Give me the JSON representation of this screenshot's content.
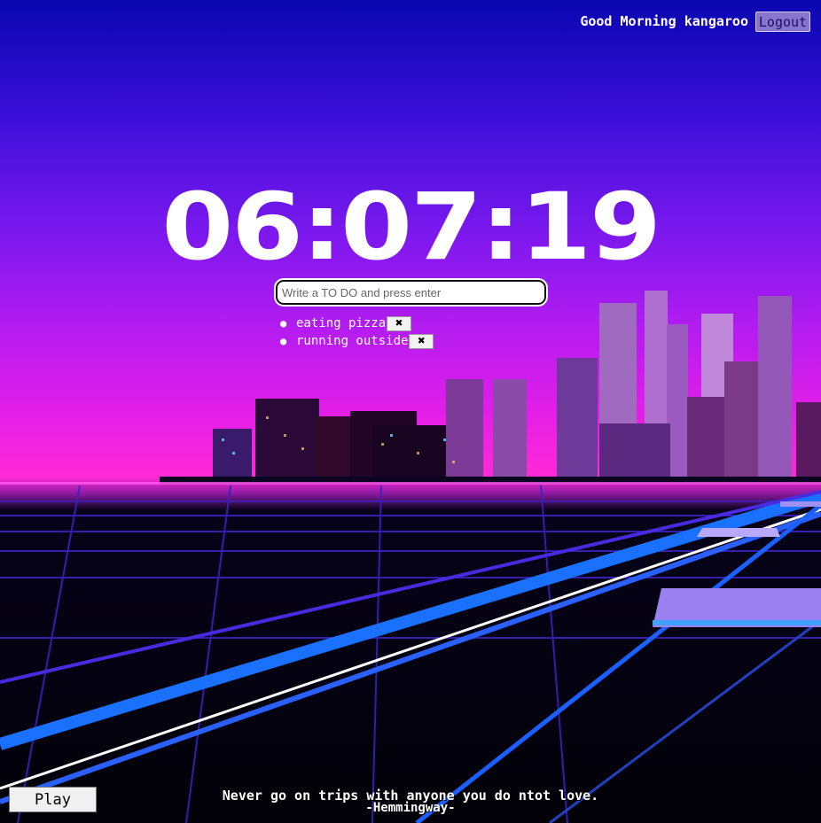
{
  "header": {
    "greeting": "Good Morning kangaroo",
    "logout_label": "Logout"
  },
  "clock": {
    "time": "06:07:19"
  },
  "todo": {
    "placeholder": "Write a TO DO and press enter",
    "items": [
      {
        "text": "eating pizza",
        "delete_symbol": "✖"
      },
      {
        "text": "running outside",
        "delete_symbol": "✖"
      }
    ]
  },
  "player": {
    "play_label": "Play"
  },
  "quote": {
    "text": "Never go on trips with anyone you do ntot love.",
    "author": "-Hemmingway-"
  }
}
